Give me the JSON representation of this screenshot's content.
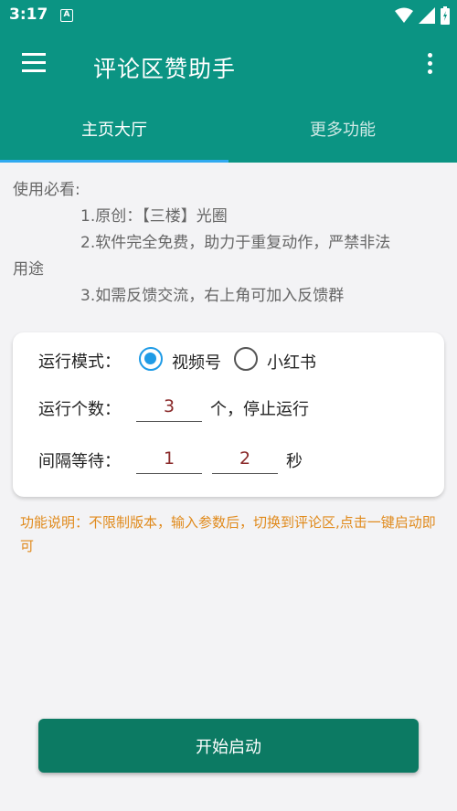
{
  "status": {
    "time": "3:17",
    "notif_glyph": "A"
  },
  "appbar": {
    "title": "评论区赞助手"
  },
  "tabs": [
    {
      "label": "主页大厅",
      "active": true
    },
    {
      "label": "更多功能",
      "active": false
    }
  ],
  "notes": {
    "heading": "使用必看:",
    "line1": "1.原创：【三楼】光圈",
    "line2": "2.软件完全免费，助力于重复动作，严禁非法",
    "line2_wrap": "用途",
    "line3": "3.如需反馈交流，右上角可加入反馈群"
  },
  "form": {
    "mode_label": "运行模式：",
    "mode_options": [
      {
        "label": "视频号",
        "checked": true
      },
      {
        "label": "小红书",
        "checked": false
      }
    ],
    "count_label": "运行个数：",
    "count_value": "3",
    "count_suffix": "个，停止运行",
    "interval_label": "间隔等待：",
    "interval_min": "1",
    "interval_max": "2",
    "interval_suffix": "秒"
  },
  "description": "功能说明：不限制版本，输入参数后，切换到评论区,点击一键启动即可",
  "start_button": "开始启动",
  "colors": {
    "primary": "#0b9483",
    "button": "#0c7a63",
    "accent": "#1f9be6",
    "desc": "#e08a1c"
  }
}
